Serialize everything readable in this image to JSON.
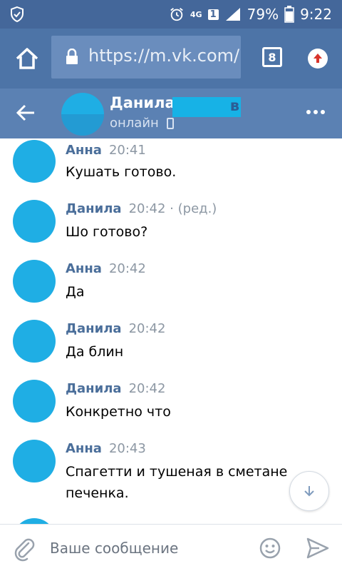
{
  "status_bar": {
    "network": "4G",
    "sim": "1",
    "battery": "79%",
    "time": "9:22"
  },
  "browser": {
    "url": "https://m.vk.com/r",
    "tab_count": "8"
  },
  "chat_header": {
    "name": "Данила",
    "name_tail": "в",
    "status": "онлайн"
  },
  "messages": [
    {
      "author": "Анна",
      "time": "20:41",
      "edited": "",
      "text": "Кушать готово."
    },
    {
      "author": "Данила",
      "time": "20:42",
      "edited": "· (ред.)",
      "text": "Шо готово?"
    },
    {
      "author": "Анна",
      "time": "20:42",
      "edited": "",
      "text": "Да"
    },
    {
      "author": "Данила",
      "time": "20:42",
      "edited": "",
      "text": "Да блин"
    },
    {
      "author": "Данила",
      "time": "20:42",
      "edited": "",
      "text": "Конкретно что"
    },
    {
      "author": "Анна",
      "time": "20:43",
      "edited": "",
      "text": "Спагетти и тушеная в сметане печенка."
    }
  ],
  "composer": {
    "placeholder": "Ваше сообщение"
  },
  "colors": {
    "status_bar": "#44679a",
    "browser_bar": "#4d74a7",
    "header": "#5b81b3",
    "author_link": "#4a6e9a",
    "avatar_blur": "#1faee4"
  }
}
